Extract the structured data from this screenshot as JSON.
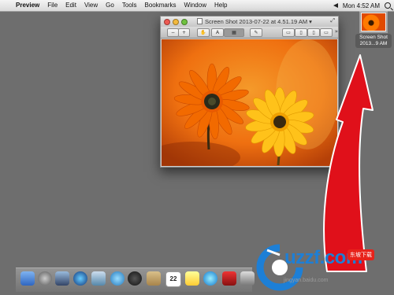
{
  "menubar": {
    "app": "Preview",
    "items": [
      "File",
      "Edit",
      "View",
      "Go",
      "Tools",
      "Bookmarks",
      "Window",
      "Help"
    ],
    "clock": "Mon 4:52 AM"
  },
  "desktop_file": {
    "label_line1": "Screen Shot",
    "label_line2": "2013...9 AM"
  },
  "window": {
    "title": "Screen Shot 2013-07-22 at 4.51.19 AM"
  },
  "dock": {
    "calendar_day": "22"
  },
  "watermark": {
    "brand": "uzzf.com",
    "chinese": "东坡下载",
    "small": "jingyan.baidu.com"
  },
  "colors": {
    "arrow": "#e0101a",
    "desktop": "#6e6e6e"
  }
}
